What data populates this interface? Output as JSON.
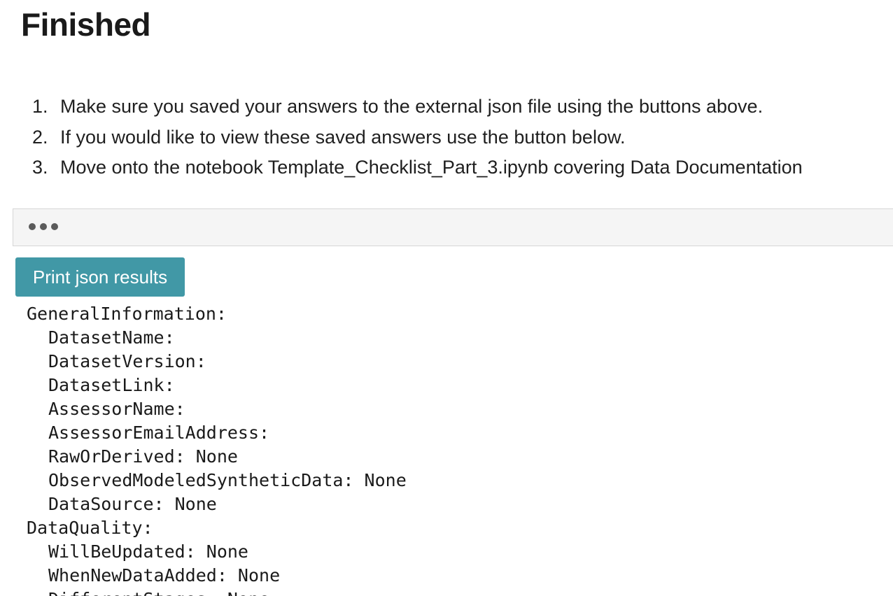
{
  "page": {
    "title": "Finished"
  },
  "instructions": [
    {
      "number": "1.",
      "text": "Make sure you saved your answers to the external json file using the buttons above."
    },
    {
      "number": "2.",
      "text": "If you would like to view these saved answers use the button below."
    },
    {
      "number": "3.",
      "text": "Move onto the notebook Template_Checklist_Part_3.ipynb covering Data Documentation"
    }
  ],
  "collapsed_output": {
    "icon": "ellipsis-icon"
  },
  "print_button": {
    "label": "Print json results",
    "color": "#4198a6"
  },
  "json_output": {
    "lines": [
      {
        "text": "GeneralInformation:",
        "indent": false
      },
      {
        "text": "DatasetName:",
        "indent": true
      },
      {
        "text": "DatasetVersion:",
        "indent": true
      },
      {
        "text": "DatasetLink:",
        "indent": true
      },
      {
        "text": "AssessorName:",
        "indent": true
      },
      {
        "text": "AssessorEmailAddress:",
        "indent": true
      },
      {
        "text": "RawOrDerived: None",
        "indent": true
      },
      {
        "text": "ObservedModeledSyntheticData: None",
        "indent": true
      },
      {
        "text": "DataSource: None",
        "indent": true
      },
      {
        "text": "DataQuality:",
        "indent": false
      },
      {
        "text": "WillBeUpdated: None",
        "indent": true
      },
      {
        "text": "WhenNewDataAdded: None",
        "indent": true
      },
      {
        "text": "DifferentStages: None",
        "indent": true
      }
    ]
  }
}
